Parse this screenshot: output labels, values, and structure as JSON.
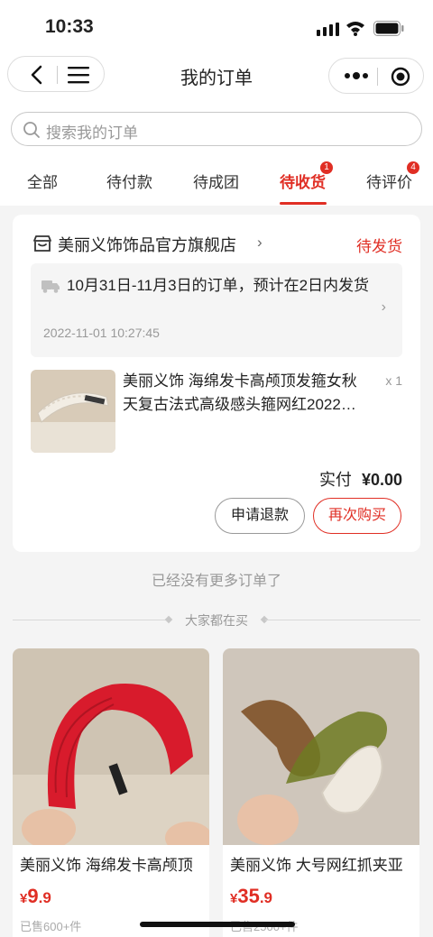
{
  "status_bar": {
    "time": "10:33",
    "icons": [
      "signal-icon",
      "wifi-icon",
      "battery-icon"
    ]
  },
  "nav": {
    "title": "我的订单",
    "icons": [
      "back-icon",
      "menu-icon",
      "more-dots-icon",
      "target-icon"
    ]
  },
  "search": {
    "placeholder": "搜索我的订单"
  },
  "tabs": [
    {
      "label": "全部"
    },
    {
      "label": "待付款"
    },
    {
      "label": "待成团"
    },
    {
      "label": "待收货",
      "badge": "1",
      "active": true
    },
    {
      "label": "待评价",
      "badge": "4"
    }
  ],
  "order": {
    "shop_name": "美丽义饰饰品官方旗舰店",
    "shop_arrow": "›",
    "status": "待发货",
    "notice_text": "10月31日-11月3日的订单，预计在2日内发货",
    "notice_date": "2022-11-01 10:27:45",
    "notice_arrow": "›",
    "product_name": "美丽义饰 海绵发卡高颅顶发箍女秋天复古法式高级感头箍网红2022…",
    "quantity": "x 1",
    "paid_label": "实付",
    "paid_amount": "¥0.00",
    "refund_button": "申请退款",
    "rebuy_button": "再次购买"
  },
  "no_more_text": "已经没有更多订单了",
  "recommend": {
    "title": "大家都在买",
    "items": [
      {
        "name": "美丽义饰 海绵发卡高颅顶",
        "currency": "¥",
        "price_int": "9",
        "price_dec": ".9",
        "sold": "已售600+件"
      },
      {
        "name": "美丽义饰 大号网红抓夹亚",
        "currency": "¥",
        "price_int": "35",
        "price_dec": ".9",
        "sold": "已售2500+件"
      }
    ]
  },
  "colors": {
    "accent": "#e02e24",
    "background": "#f4f4f4"
  }
}
